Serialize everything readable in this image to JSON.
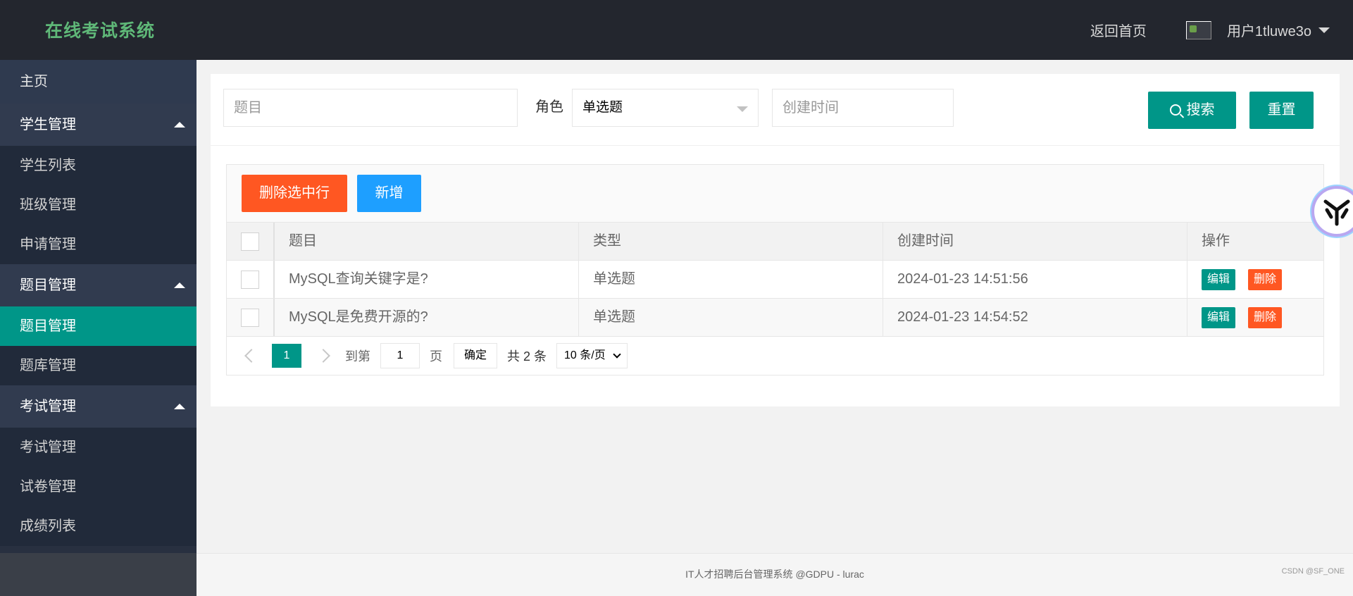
{
  "header": {
    "logo": "在线考试系统",
    "home_link": "返回首页",
    "user_name": "用户1tluwe3o"
  },
  "sidebar": {
    "home": "主页",
    "groups": [
      {
        "label": "学生管理",
        "children": [
          "学生列表",
          "班级管理",
          "申请管理"
        ]
      },
      {
        "label": "题目管理",
        "children": [
          "题目管理",
          "题库管理"
        ]
      },
      {
        "label": "考试管理",
        "children": [
          "考试管理",
          "试卷管理",
          "成绩列表"
        ]
      }
    ],
    "active_item": "题目管理"
  },
  "search": {
    "title_placeholder": "题目",
    "role_label": "角色",
    "role_selected": "单选题",
    "time_placeholder": "创建时间",
    "search_label": "搜索",
    "reset_label": "重置"
  },
  "toolbar": {
    "delete_selected": "删除选中行",
    "add": "新增"
  },
  "table": {
    "columns": [
      "题目",
      "类型",
      "创建时间",
      "操作"
    ],
    "rows": [
      {
        "title": "MySQL查询关键字是?",
        "type": "单选题",
        "created": "2024-01-23 14:51:56"
      },
      {
        "title": "MySQL是免费开源的?",
        "type": "单选题",
        "created": "2024-01-23 14:54:52"
      }
    ],
    "edit_label": "编辑",
    "delete_label": "删除"
  },
  "pager": {
    "current": "1",
    "goto_label": "到第",
    "goto_value": "1",
    "page_label": "页",
    "confirm": "确定",
    "total": "共 2 条",
    "limit": "10 条/页"
  },
  "footer": {
    "text": "IT人才招聘后台管理系统 @GDPU - lurac",
    "watermark": "CSDN @SF_ONE"
  },
  "colors": {
    "header_bg": "#23262e",
    "sidebar_bg": "#283040",
    "accent_teal": "#009688",
    "danger_orange": "#ff5722",
    "primary_blue": "#1e9fff",
    "logo_green": "#5fb878"
  }
}
